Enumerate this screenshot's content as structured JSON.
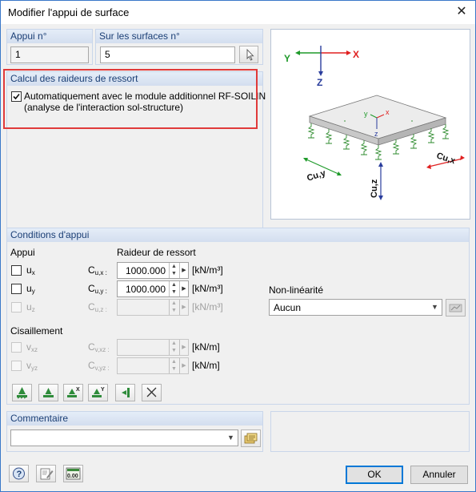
{
  "window": {
    "title": "Modifier l'appui de surface"
  },
  "support_no": {
    "label": "Appui n°",
    "value": "1"
  },
  "surfaces_no": {
    "label": "Sur les surfaces n°",
    "value": "5"
  },
  "spring_calc": {
    "label": "Calcul des raideurs de ressort",
    "auto_checked": true,
    "auto_line1": "Automatiquement avec le module additionnel RF-SOILIN",
    "auto_line2": "(analyse de l'interaction sol-structure)"
  },
  "preview": {
    "axis_x": "X",
    "axis_y": "Y",
    "axis_z": "Z",
    "local_x": "x",
    "local_y": "y",
    "local_z": "z",
    "label_cuy": "Cu,y",
    "label_cux": "Cu,x",
    "label_cuz": "Cu,z",
    "colors": {
      "x_axis": "#e02020",
      "y_axis": "#1f9a2a",
      "z_axis": "#2a3d9c",
      "local_z": "#e02020"
    }
  },
  "conditions": {
    "label": "Conditions d'appui",
    "appui_label": "Appui",
    "stiffness_label": "Raideur de ressort",
    "rows": [
      {
        "dof": "u",
        "sub": "x",
        "checked": false,
        "enabled": true,
        "coef": "C",
        "coef_sub": "u,x :",
        "value": "1000.000",
        "unit": "[kN/m³]"
      },
      {
        "dof": "u",
        "sub": "y",
        "checked": false,
        "enabled": true,
        "coef": "C",
        "coef_sub": "u,y :",
        "value": "1000.000",
        "unit": "[kN/m³]"
      },
      {
        "dof": "u",
        "sub": "z",
        "checked": false,
        "enabled": false,
        "coef": "C",
        "coef_sub": "u,z :",
        "value": "",
        "unit": "[kN/m³]"
      }
    ],
    "shear_label": "Cisaillement",
    "shear_rows": [
      {
        "dof": "v",
        "sub": "xz",
        "checked": false,
        "enabled": false,
        "coef": "C",
        "coef_sub": "v,xz :",
        "value": "",
        "unit": "[kN/m]"
      },
      {
        "dof": "v",
        "sub": "yz",
        "checked": false,
        "enabled": false,
        "coef": "C",
        "coef_sub": "v,yz :",
        "value": "",
        "unit": "[kN/m]"
      }
    ],
    "nonlinearity_label": "Non-linéarité",
    "nonlinearity_value": "Aucun"
  },
  "comment": {
    "label": "Commentaire",
    "value": ""
  },
  "buttons": {
    "ok": "OK",
    "cancel": "Annuler"
  },
  "toolbar_icons": [
    "support-fixed-icon",
    "support-hinged-icon",
    "support-x-icon",
    "support-y-icon",
    "green-flag-icon",
    "clear-icon"
  ],
  "footer_icons": [
    "help-icon",
    "edit-icon",
    "units-icon"
  ],
  "footer_units_text": "0.00"
}
